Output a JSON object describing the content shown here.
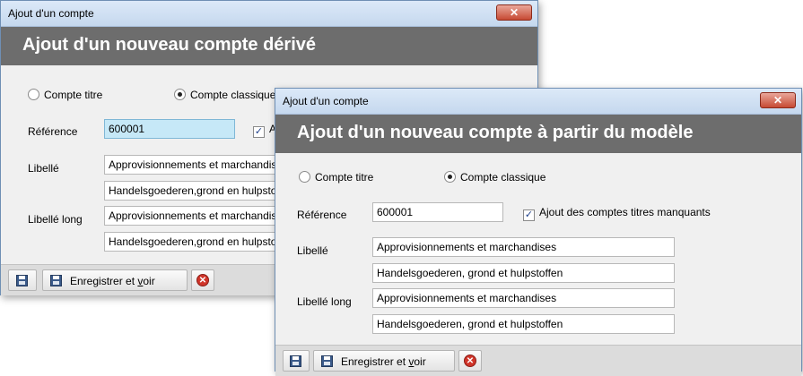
{
  "back_window": {
    "title": "Ajout d'un compte",
    "close_glyph": "✕",
    "header": "Ajout d'un nouveau compte dérivé",
    "radio_titre": "Compte titre",
    "radio_classique": "Compte classique",
    "reference_label": "Référence",
    "reference_value": "600001",
    "checkbox_partial": "A",
    "libelle_label": "Libellé",
    "libelle_fr": "Approvisionnements et marchandises",
    "libelle_nl": "Handelsgoederen,grond en hulpstoffen",
    "libelle_long_label": "Libellé long",
    "libelle_long_fr": "Approvisionnements et marchandises",
    "libelle_long_nl": "Handelsgoederen,grond en hulpstoffen",
    "save_view_pre": "Enregistrer et ",
    "save_view_ul": "v",
    "save_view_post": "oir",
    "cancel_glyph": "✕"
  },
  "front_window": {
    "title": "Ajout d'un compte",
    "close_glyph": "✕",
    "header": "Ajout d'un nouveau compte à partir du modèle",
    "radio_titre": "Compte titre",
    "radio_classique": "Compte classique",
    "reference_label": "Référence",
    "reference_value": "600001",
    "checkbox_label": "Ajout des comptes titres manquants",
    "libelle_label": "Libellé",
    "libelle_fr": "Approvisionnements et marchandises",
    "libelle_nl": "Handelsgoederen, grond et hulpstoffen",
    "libelle_long_label": "Libellé long",
    "libelle_long_fr": "Approvisionnements et marchandises",
    "libelle_long_nl": "Handelsgoederen, grond et hulpstoffen",
    "save_view_pre": "Enregistrer et ",
    "save_view_ul": "v",
    "save_view_post": "oir",
    "cancel_glyph": "✕"
  },
  "checkbox_mark": "✓"
}
